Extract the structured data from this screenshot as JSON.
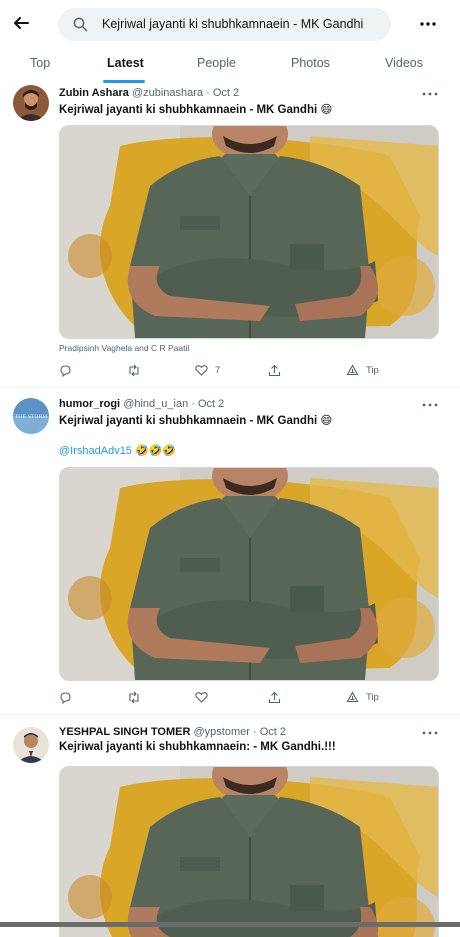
{
  "search": {
    "query": "Kejriwal jayanti ki shubhkamnaein - MK Gandhi"
  },
  "tabs": [
    "Top",
    "Latest",
    "People",
    "Photos",
    "Videos"
  ],
  "active_tab": "Latest",
  "colors": {
    "accent": "#1d9bf0",
    "muted": "#536471",
    "text": "#0f1419"
  },
  "icons": {
    "header": [
      "back-arrow-icon",
      "search-icon",
      "more-icon"
    ],
    "actions": [
      "reply-icon",
      "retweet-icon",
      "like-icon",
      "share-icon",
      "tip-icon"
    ]
  },
  "tweets": [
    {
      "name": "Zubin Ashara",
      "handle": "@zubinashara",
      "sep": "·",
      "date": "Oct 2",
      "text": "Kejriwal jayanti ki shubhkamnaein - MK Gandhi 😄",
      "caption": "Pradipsinh Vaghela and C R Paatil",
      "likes": "7",
      "tip": "Tip"
    },
    {
      "name": "humor_rogi",
      "handle": "@hind_u_ian",
      "sep": "·",
      "date": "Oct 2",
      "text": "Kejriwal jayanti ki shubhkamnaein - MK Gandhi 😄",
      "mention": "@IrshadAdv15",
      "mention_emoji": "🤣🤣🤣",
      "avatar_text": "THE STORM",
      "tip": "Tip"
    },
    {
      "name": "YESHPAL SINGH TOMER",
      "handle": "@ypstomer",
      "sep": "·",
      "date": "Oct 2",
      "text": "Kejriwal jayanti ki shubhkamnaein: - MK Gandhi.!!!"
    }
  ]
}
